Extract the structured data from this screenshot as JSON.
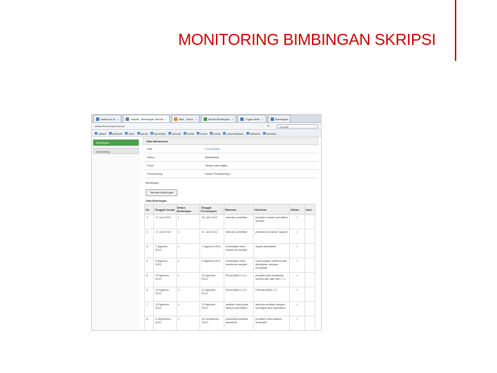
{
  "slide": {
    "title": "MONITORING BIMBINGAN SKRIPSI"
  },
  "browser": {
    "tabs": [
      {
        "label": "siakad.ac.id",
        "active": false
      },
      {
        "label": "siakad - Bimbingan Skripsi",
        "active": true
      },
      {
        "label": "Mail - Inbox",
        "active": false
      },
      {
        "label": "Modul Bimbingan",
        "active": false
      },
      {
        "label": "Tugas Akhir",
        "active": false
      },
      {
        "label": "Bimbingan",
        "active": false
      }
    ],
    "url": "siakad/bimbingan/skripsi",
    "search_placeholder": "Google",
    "bookmarks": [
      "siakad",
      "webmail",
      "drive",
      "jurnal",
      "repository",
      "scholar",
      "berita",
      "forum",
      "portal",
      "perpustakaan",
      "kalender",
      "bantuan"
    ]
  },
  "sidebar": {
    "items": [
      {
        "label": "Bimbingan"
      },
      {
        "label": "Monitoring"
      }
    ]
  },
  "main": {
    "panel_title": "Data Mahasiswa",
    "fields": [
      {
        "label": "NIM",
        "value": "0712100011",
        "link": true
      },
      {
        "label": "Nama",
        "value": "Mahasiswa",
        "link": false
      },
      {
        "label": "Prodi",
        "value": "Teknik Informatika",
        "link": false
      },
      {
        "label": "Pembimbing",
        "value": "Dosen Pembimbing I",
        "link": false
      }
    ],
    "section_label": "Bimbingan",
    "add_button": "Tambah Bimbingan",
    "table_title": "Data Bimbingan",
    "columns": [
      "No",
      "Tanggal Usulan",
      "Status Bimbingan",
      "Tanggal Persetujuan",
      "Bahasan",
      "Masukan",
      "Status",
      "Opsi"
    ],
    "rows": [
      {
        "no": "1",
        "tgl_usulan": "17 Juni 2012",
        "status_bimbingan": "1",
        "tgl_persetujuan": "18 Juni 2012",
        "bahasan": "metode penelitian",
        "masukan": "perbaiki metode penelitian sampel",
        "status": "✓"
      },
      {
        "no": "2",
        "tgl_usulan": "17 Juni 2012",
        "status_bimbingan": "2",
        "tgl_persetujuan": "21 Juni 2012",
        "bahasan": "metode penelitian",
        "masukan": "perbaiki kuesioner sampel",
        "status": "✓"
      },
      {
        "no": "3",
        "tgl_usulan": "7 Agustus 2012",
        "status_bimbingan": "1",
        "tgl_persetujuan": "7 Agustus 2012",
        "bahasan": "Konsultasi hasil kuesioner sampel",
        "masukan": "dapat dilanjutkan",
        "status": "✓"
      },
      {
        "no": "4",
        "tgl_usulan": "9 Agustus 2012",
        "status_bimbingan": "2",
        "tgl_persetujuan": "9 Agustus 2012",
        "bahasan": "Konsultasi hasil kuesioner sampel",
        "masukan": "hasil sampel diterima dan dianjurkan dengan penelitian",
        "status": "✓"
      },
      {
        "no": "5",
        "tgl_usulan": "10 Agustus 2012",
        "status_bimbingan": "1",
        "tgl_persetujuan": "10 Agustus 2012",
        "bahasan": "Revisi BAB 1,2,3",
        "masukan": "perbaiki latar belakang sesuai ada dari bab 1, 3",
        "status": "✓"
      },
      {
        "no": "6",
        "tgl_usulan": "11 Agustus 2012",
        "status_bimbingan": "2",
        "tgl_persetujuan": "12 Agustus 2012",
        "bahasan": "Revisi BAB 1,2,3",
        "masukan": "Perbaiki BAB 1-3",
        "status": "✓"
      },
      {
        "no": "7",
        "tgl_usulan": "13 Agustus 2012",
        "status_bimbingan": "1",
        "tgl_persetujuan": "13 Agustus 2012",
        "bahasan": "analisis data pada sampel penelitian",
        "masukan": "lakukan analisis dengan kerangka teori penelitian",
        "status": "✓"
      },
      {
        "no": "8",
        "tgl_usulan": "3 September 2012",
        "status_bimbingan": "2",
        "tgl_persetujuan": "18 September 2012",
        "bahasan": "konsultasi analisis deskriptif",
        "masukan": "perbaiki hasil analisis deskriptif",
        "status": "✓"
      }
    ]
  }
}
